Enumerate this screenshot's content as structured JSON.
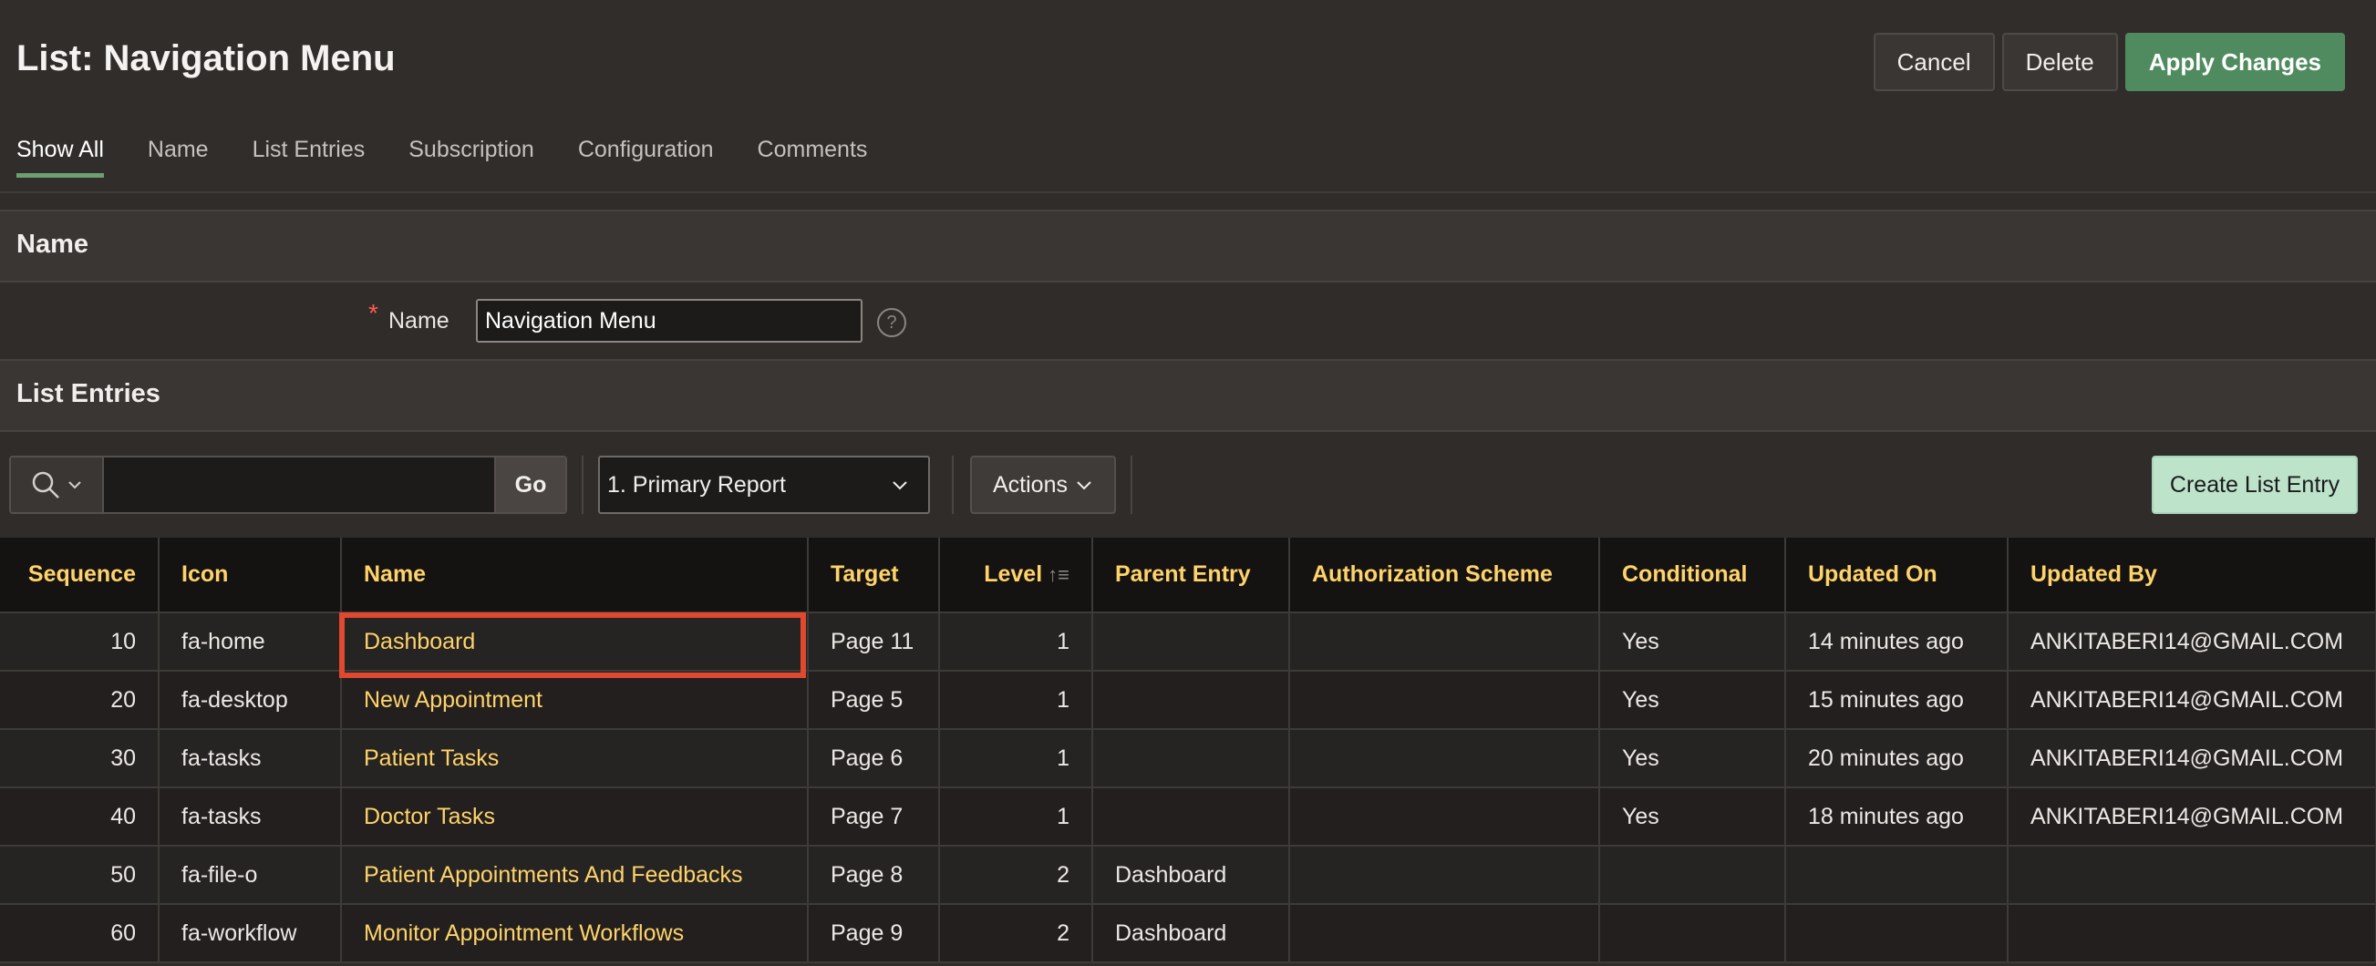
{
  "header": {
    "title": "List: Navigation Menu",
    "cancel_label": "Cancel",
    "delete_label": "Delete",
    "apply_label": "Apply Changes"
  },
  "tabs": [
    {
      "label": "Show All",
      "active": true
    },
    {
      "label": "Name"
    },
    {
      "label": "List Entries"
    },
    {
      "label": "Subscription"
    },
    {
      "label": "Configuration"
    },
    {
      "label": "Comments"
    }
  ],
  "name_section": {
    "title": "Name",
    "required_mark": "*",
    "field_label": "Name",
    "field_value": "Navigation Menu",
    "help_glyph": "?"
  },
  "list_entries": {
    "title": "List Entries",
    "go_label": "Go",
    "report_selected": "1. Primary Report",
    "actions_label": "Actions",
    "create_label": "Create List Entry",
    "columns": [
      "Sequence",
      "Icon",
      "Name",
      "Target",
      "Level",
      "Parent Entry",
      "Authorization Scheme",
      "Conditional",
      "Updated On",
      "Updated By"
    ],
    "rows": [
      {
        "sequence": "10",
        "icon": "fa-home",
        "name": "Dashboard",
        "target": "Page 11",
        "level": "1",
        "parent": "",
        "auth": "",
        "conditional": "Yes",
        "updated_on": "14 minutes ago",
        "updated_by": "ANKITABERI14@GMAIL.COM"
      },
      {
        "sequence": "20",
        "icon": "fa-desktop",
        "name": "New Appointment",
        "target": "Page 5",
        "level": "1",
        "parent": "",
        "auth": "",
        "conditional": "Yes",
        "updated_on": "15 minutes ago",
        "updated_by": "ANKITABERI14@GMAIL.COM"
      },
      {
        "sequence": "30",
        "icon": "fa-tasks",
        "name": "Patient Tasks",
        "target": "Page 6",
        "level": "1",
        "parent": "",
        "auth": "",
        "conditional": "Yes",
        "updated_on": "20 minutes ago",
        "updated_by": "ANKITABERI14@GMAIL.COM"
      },
      {
        "sequence": "40",
        "icon": "fa-tasks",
        "name": "Doctor Tasks",
        "target": "Page 7",
        "level": "1",
        "parent": "",
        "auth": "",
        "conditional": "Yes",
        "updated_on": "18 minutes ago",
        "updated_by": "ANKITABERI14@GMAIL.COM"
      },
      {
        "sequence": "50",
        "icon": "fa-file-o",
        "name": "Patient Appointments And Feedbacks",
        "target": "Page 8",
        "level": "2",
        "parent": "Dashboard",
        "auth": "",
        "conditional": "",
        "updated_on": "",
        "updated_by": ""
      },
      {
        "sequence": "60",
        "icon": "fa-workflow",
        "name": "Monitor Appointment Workflows",
        "target": "Page 9",
        "level": "2",
        "parent": "Dashboard",
        "auth": "",
        "conditional": "",
        "updated_on": "",
        "updated_by": ""
      }
    ]
  },
  "colors": {
    "background": "#2f2c2a",
    "header_text": "#ffd36a",
    "apply_button": "#4f8b5f",
    "create_button": "#bde3cb",
    "highlight_box": "#e0482f"
  }
}
